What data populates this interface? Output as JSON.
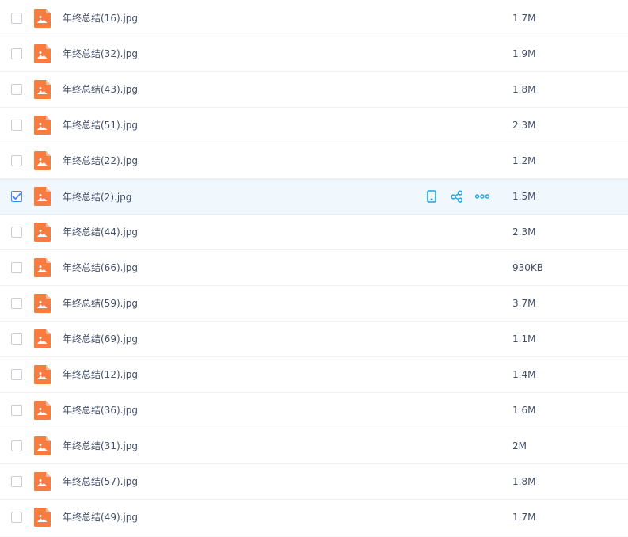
{
  "files": [
    {
      "name": "年终总结(16).jpg",
      "size": "1.7M",
      "selected": false
    },
    {
      "name": "年终总结(32).jpg",
      "size": "1.9M",
      "selected": false
    },
    {
      "name": "年终总结(43).jpg",
      "size": "1.8M",
      "selected": false
    },
    {
      "name": "年终总结(51).jpg",
      "size": "2.3M",
      "selected": false
    },
    {
      "name": "年终总结(22).jpg",
      "size": "1.2M",
      "selected": false
    },
    {
      "name": "年终总结(2).jpg",
      "size": "1.5M",
      "selected": true
    },
    {
      "name": "年终总结(44).jpg",
      "size": "2.3M",
      "selected": false
    },
    {
      "name": "年终总结(66).jpg",
      "size": "930KB",
      "selected": false
    },
    {
      "name": "年终总结(59).jpg",
      "size": "3.7M",
      "selected": false
    },
    {
      "name": "年终总结(69).jpg",
      "size": "1.1M",
      "selected": false
    },
    {
      "name": "年终总结(12).jpg",
      "size": "1.4M",
      "selected": false
    },
    {
      "name": "年终总结(36).jpg",
      "size": "1.6M",
      "selected": false
    },
    {
      "name": "年终总结(31).jpg",
      "size": "2M",
      "selected": false
    },
    {
      "name": "年终总结(57).jpg",
      "size": "1.8M",
      "selected": false
    },
    {
      "name": "年终总结(49).jpg",
      "size": "1.7M",
      "selected": false
    }
  ],
  "row_actions": [
    {
      "icon": "phone-icon"
    },
    {
      "icon": "share-icon"
    },
    {
      "icon": "more-icon"
    }
  ],
  "colors": {
    "image_icon": "#f87b3f",
    "selected_row_bg": "#f1f8fd",
    "accent": "#1aa3e8",
    "checkbox_check": "#3b8cff",
    "text": "#424e67"
  }
}
